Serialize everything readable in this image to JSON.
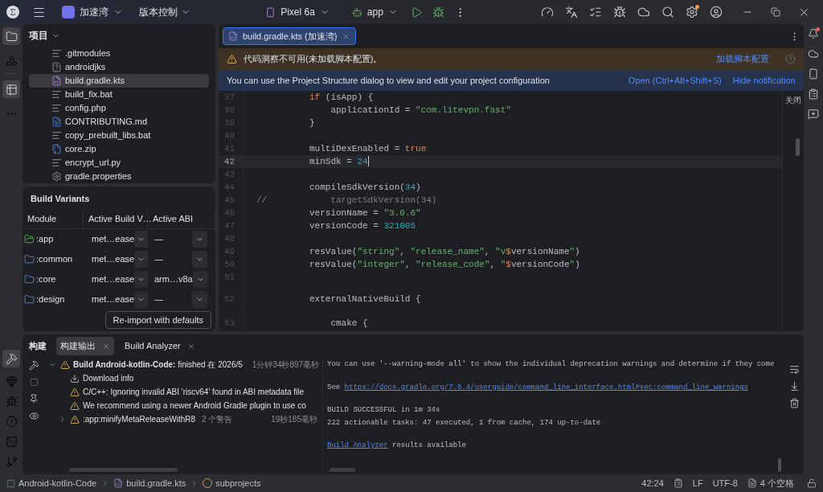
{
  "title_bar": {
    "project": "加速湾",
    "vcs": "版本控制",
    "device": "Pixel 6a",
    "run_config": "app"
  },
  "project_panel": {
    "title": "项目",
    "files": [
      {
        "name": ".gitmodules",
        "kind": "text",
        "selected": false
      },
      {
        "name": "androidjks",
        "kind": "unknown",
        "selected": false
      },
      {
        "name": "build.gradle.kts",
        "kind": "gradle",
        "selected": true
      },
      {
        "name": "build_fix.bat",
        "kind": "text",
        "selected": false
      },
      {
        "name": "config.php",
        "kind": "text",
        "selected": false
      },
      {
        "name": "CONTRIBUTING.md",
        "kind": "markdown",
        "selected": false
      },
      {
        "name": "copy_prebuilt_libs.bat",
        "kind": "text",
        "selected": false
      },
      {
        "name": "core.zip",
        "kind": "archive",
        "selected": false
      },
      {
        "name": "encrypt_url.py",
        "kind": "text",
        "selected": false
      },
      {
        "name": "gradle.properties",
        "kind": "settings",
        "selected": false
      }
    ]
  },
  "build_variants": {
    "title": "Build Variants",
    "columns": [
      "Module",
      "Active Build V…",
      "Active ABI"
    ],
    "rows": [
      {
        "module": ":app",
        "kind": "app",
        "variant": "met…ease",
        "abi": "—"
      },
      {
        "module": ":common",
        "kind": "library",
        "variant": "met…ease",
        "abi": "—"
      },
      {
        "module": ":core",
        "kind": "library",
        "variant": "met…ease",
        "abi": "arm…v8a"
      },
      {
        "module": ":design",
        "kind": "library",
        "variant": "met…ease",
        "abi": "—"
      }
    ],
    "reimport_button": "Re-import with defaults"
  },
  "editor": {
    "tabs": [
      {
        "label": "build.gradle.kts (加速湾)",
        "selected": true
      }
    ],
    "warning_banner": {
      "text": "代码洞察不可用(未加载脚本配置)。",
      "action": "加载脚本配置"
    },
    "info_banner": {
      "text": "You can use the Project Structure dialog to view and edit your project configuration",
      "actions": [
        "Open (Ctrl+Alt+Shift+S)",
        "Hide notification"
      ]
    },
    "close_hint": "关闭",
    "lines": [
      {
        "number": "37",
        "current": false,
        "tokens": [
          {
            "kind": "keyword",
            "text": "          if"
          },
          {
            "kind": "plain",
            "text": " (isApp) {"
          }
        ]
      },
      {
        "number": "38",
        "current": false,
        "tokens": [
          {
            "kind": "plain",
            "text": "              applicationId = "
          },
          {
            "kind": "string",
            "text": "\"com.litevpn.fast\""
          }
        ]
      },
      {
        "number": "39",
        "current": false,
        "tokens": [
          {
            "kind": "plain",
            "text": "          }"
          }
        ]
      },
      {
        "number": "40",
        "current": false
      },
      {
        "number": "41",
        "current": false,
        "tokens": [
          {
            "kind": "plain",
            "text": "          multiDexEnabled = "
          },
          {
            "kind": "keyword",
            "text": "true"
          }
        ]
      },
      {
        "number": "42",
        "current": true,
        "tokens": [
          {
            "kind": "plain",
            "text": "          minSdk = "
          },
          {
            "kind": "number",
            "text": "24"
          }
        ]
      },
      {
        "number": "43",
        "current": false
      },
      {
        "number": "44",
        "current": false,
        "tokens": [
          {
            "kind": "plain",
            "text": "          compileSdkVersion("
          },
          {
            "kind": "number",
            "text": "34"
          },
          {
            "kind": "plain",
            "text": ")"
          }
        ]
      },
      {
        "number": "45",
        "current": false,
        "tokens": [
          {
            "kind": "comment",
            "text": "//            targetSdkVersion(34)"
          }
        ]
      },
      {
        "number": "46",
        "current": false,
        "tokens": [
          {
            "kind": "plain",
            "text": "          versionName = "
          },
          {
            "kind": "string",
            "text": "\"3.0.6\""
          }
        ]
      },
      {
        "number": "47",
        "current": false,
        "tokens": [
          {
            "kind": "plain",
            "text": "          versionCode = "
          },
          {
            "kind": "number",
            "text": "321005"
          }
        ]
      },
      {
        "number": "48",
        "current": false
      },
      {
        "number": "49",
        "current": false,
        "tokens": [
          {
            "kind": "plain",
            "text": "          resValue("
          },
          {
            "kind": "string",
            "text": "\"string\""
          },
          {
            "kind": "plain",
            "text": ", "
          },
          {
            "kind": "string",
            "text": "\"release_name\""
          },
          {
            "kind": "plain",
            "text": ", "
          },
          {
            "kind": "string",
            "text": "\"v"
          },
          {
            "kind": "template",
            "text": "$"
          },
          {
            "kind": "plain",
            "text": "versionName"
          },
          {
            "kind": "string",
            "text": "\""
          },
          {
            "kind": "plain",
            "text": ")"
          }
        ]
      },
      {
        "number": "50",
        "current": false,
        "tokens": [
          {
            "kind": "plain",
            "text": "          resValue("
          },
          {
            "kind": "string",
            "text": "\"integer\""
          },
          {
            "kind": "plain",
            "text": ", "
          },
          {
            "kind": "string",
            "text": "\"release_code\""
          },
          {
            "kind": "plain",
            "text": ", "
          },
          {
            "kind": "string",
            "text": "\""
          },
          {
            "kind": "template",
            "text": "$"
          },
          {
            "kind": "plain",
            "text": "versionCode"
          },
          {
            "kind": "string",
            "text": "\""
          },
          {
            "kind": "plain",
            "text": ")"
          }
        ]
      },
      {
        "number": "51",
        "current": false
      },
      {
        "number": "52",
        "current": false,
        "inlay_gap": true,
        "tokens": [
          {
            "kind": "plain",
            "text": "          externalNativeBuild {"
          }
        ]
      },
      {
        "number": "53",
        "current": false,
        "inlay_gap": true,
        "tokens": [
          {
            "kind": "plain",
            "text": "              cmake {"
          }
        ]
      }
    ]
  },
  "build_window": {
    "title": "构建",
    "tabs": [
      {
        "label": "构建输出",
        "selected": true
      },
      {
        "label": "Build Analyzer",
        "selected": false
      }
    ],
    "tree": [
      {
        "text": "**Build Android-kotlin-Code:** finished 在 2026/5",
        "time": "1分钟34秒897毫秒",
        "kind": "warning",
        "expanded": true,
        "children": [
          {
            "text": "Download info",
            "kind": "download"
          },
          {
            "text": "C/C++: Ignoring invalid ABI 'riscv64' found in ABI metadata file",
            "kind": "warning"
          },
          {
            "text": "We recommend using a newer Android Gradle plugin to use co",
            "kind": "warning"
          },
          {
            "text": ":app:minifyMetaReleaseWithR8",
            "note": "2 个警告",
            "time": "19秒185毫秒",
            "kind": "warning",
            "expanded": false
          }
        ]
      }
    ],
    "console": [
      {
        "gap_before": false,
        "segments": [
          {
            "text": "You can use '--warning-mode all' to show the individual deprecation warnings and determine if they come",
            "link": false
          }
        ]
      },
      {
        "gap_before": true,
        "segments": [
          {
            "text": "See ",
            "link": false
          },
          {
            "text": "https://docs.gradle.org/7.6.4/userguide/command_line_interface.html#sec:command_line_warnings",
            "link": true
          }
        ]
      },
      {
        "gap_before": true,
        "segments": [
          {
            "text": "BUILD SUCCESSFUL in 1m 34s",
            "link": false
          }
        ]
      },
      {
        "gap_before": false,
        "segments": [
          {
            "text": "222 actionable tasks: 47 executed, 1 from cache, 174 up-to-date",
            "link": false
          }
        ]
      },
      {
        "gap_before": true,
        "segments": [
          {
            "text": "Build Analyzer",
            "link": true
          },
          {
            "text": " results available",
            "link": false
          }
        ]
      }
    ]
  },
  "status_bar": {
    "breadcrumbs": [
      {
        "label": "Android-kotlin-Code",
        "kind": "module"
      },
      {
        "label": "build.gradle.kts",
        "kind": "gradle"
      },
      {
        "label": "subprojects",
        "kind": "lambda"
      }
    ],
    "position": "42:24",
    "line_separator": "LF",
    "encoding": "UTF-8",
    "indent": "4 个空格"
  }
}
